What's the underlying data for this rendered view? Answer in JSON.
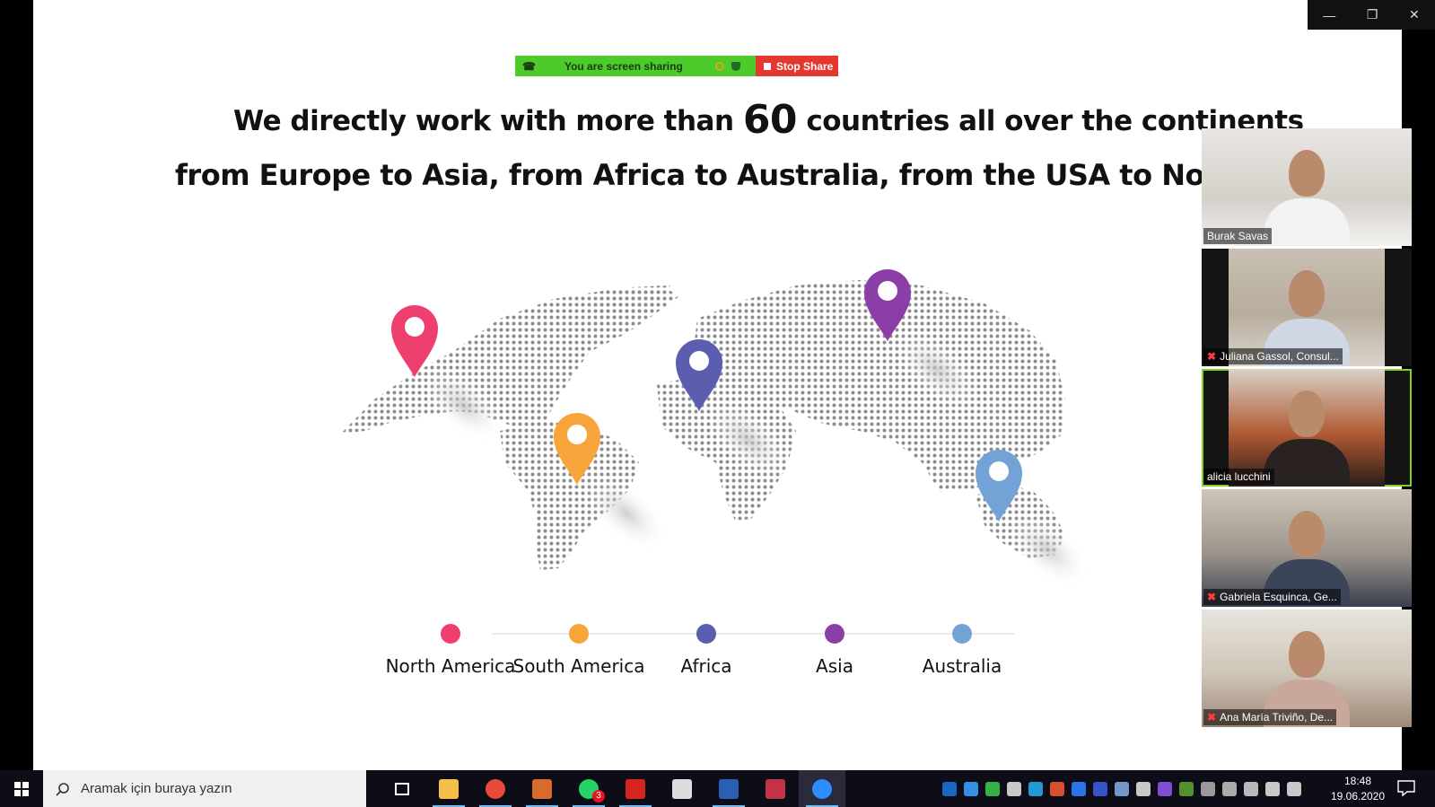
{
  "share_bar": {
    "status": "You are screen sharing",
    "stop_label": "Stop Share"
  },
  "slide": {
    "line1_before": "We directly work with more than ",
    "line1_number": "60",
    "line1_after": " countries all over the continents",
    "line2": "from Europe to Asia, from Africa to Australia, from the USA to North Ame",
    "legend": [
      {
        "label": "North America",
        "color": "#ee3f6f"
      },
      {
        "label": "South America",
        "color": "#f7a53a"
      },
      {
        "label": "Africa",
        "color": "#5b5eaf"
      },
      {
        "label": "Asia",
        "color": "#8c3ea8"
      },
      {
        "label": "Australia",
        "color": "#73a3d6"
      }
    ]
  },
  "participants": [
    {
      "name": "Burak Savas",
      "muted": false,
      "active": false
    },
    {
      "name": "Juliana Gassol, Consul...",
      "muted": true,
      "active": false
    },
    {
      "name": "alicia lucchini",
      "muted": false,
      "active": true
    },
    {
      "name": "Gabriela Esquinca, Ge...",
      "muted": true,
      "active": false
    },
    {
      "name": "Ana María Triviño, De...",
      "muted": true,
      "active": false
    }
  ],
  "taskbar": {
    "search_placeholder": "Aramak için buraya yazın",
    "time": "18:48",
    "date": "19.06.2020",
    "whatsapp_badge": "3",
    "apps": [
      "task-view",
      "file-explorer",
      "chrome",
      "snip-tool",
      "whatsapp",
      "acrobat",
      "calculator",
      "word",
      "media-player",
      "zoom"
    ]
  },
  "colors": {
    "share_green": "#4ccb2a",
    "stop_red": "#e4372f",
    "active_speaker": "#7ed321"
  }
}
